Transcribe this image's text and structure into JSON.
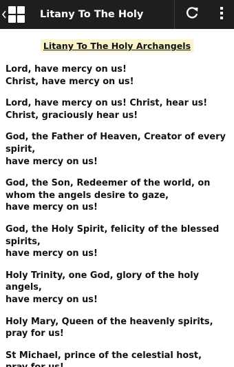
{
  "action_bar": {
    "title": "Litany To The Holy A.."
  },
  "content": {
    "heading": "Litany To The Holy Archangels",
    "verses": [
      [
        "Lord, have mercy on us!",
        "Christ, have mercy on us!"
      ],
      [
        "Lord, have mercy on us! Christ, hear us!",
        "Christ, graciously hear us!"
      ],
      [
        "God, the Father of Heaven, Creator of every spirit,",
        "have mercy on us!"
      ],
      [
        "God, the Son, Redeemer of the world, on whom the angels desire to gaze,",
        "have mercy on us!"
      ],
      [
        "God, the Holy Spirit, felicity of the blessed spirits,",
        "have mercy on us!"
      ],
      [
        "Holy Trinity, one God, glory of the holy angels,",
        "have mercy on us!"
      ],
      [
        "Holy Mary, Queen of the heavenly spirits,",
        "pray for us!"
      ],
      [
        "St Michael, prince of the celestial host,",
        "pray for us!"
      ]
    ]
  },
  "icons": {
    "up": "chevron-left-icon",
    "app": "grid-icon",
    "refresh": "refresh-icon",
    "overflow": "more-vertical-icon"
  },
  "colors": {
    "action_bar": "#1e1e1e",
    "heading_highlight": "#fbf3c9",
    "text": "#111111"
  }
}
